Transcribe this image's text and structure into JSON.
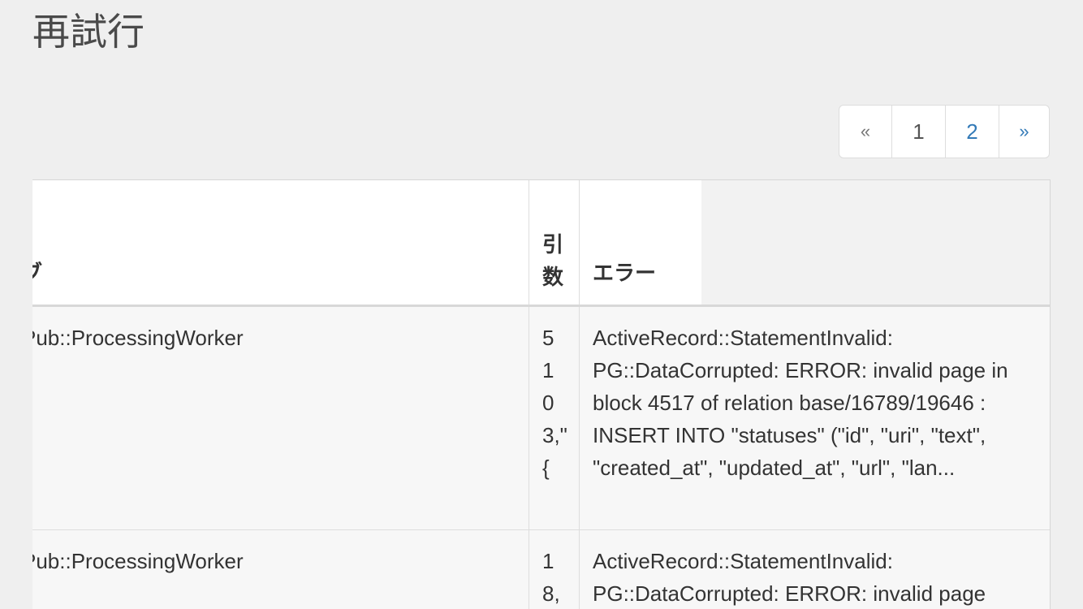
{
  "page": {
    "title": "再試行"
  },
  "pagination": {
    "prev": "«",
    "pages": [
      "1",
      "2"
    ],
    "next": "»"
  },
  "table": {
    "headers": {
      "job": "ブ",
      "args": "引数",
      "error": "エラー"
    },
    "rows": [
      {
        "job": "vityPub::ProcessingWorker",
        "args": "5103,\"{",
        "error": "ActiveRecord::StatementInvalid: PG::DataCorrupted: ERROR: invalid page in block 4517 of relation base/16789/19646 : INSERT INTO \"statuses\" (\"id\", \"uri\", \"text\", \"created_at\", \"updated_at\", \"url\", \"lan..."
      },
      {
        "job": "vityPub::ProcessingWorker",
        "args": "18,",
        "error": "ActiveRecord::StatementInvalid: PG::DataCorrupted: ERROR: invalid page"
      }
    ]
  }
}
